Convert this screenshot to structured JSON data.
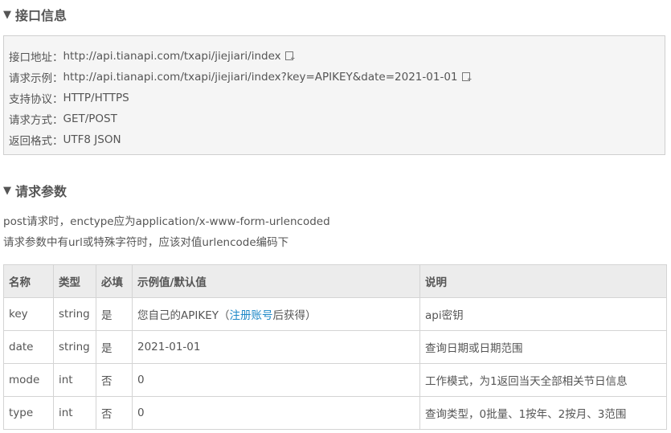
{
  "sections": {
    "info_title": "接口信息",
    "params_title": "请求参数"
  },
  "info": {
    "address_label": "接口地址：",
    "address_value": "http://api.tianapi.com/txapi/jiejiari/index",
    "example_label": "请求示例：",
    "example_value": "http://api.tianapi.com/txapi/jiejiari/index?key=APIKEY&date=2021-01-01",
    "protocol_label": "支持协议：",
    "protocol_value": "HTTP/HTTPS",
    "method_label": "请求方式：",
    "method_value": "GET/POST",
    "format_label": "返回格式：",
    "format_value": "UTF8 JSON"
  },
  "notes": {
    "line1": "post请求时，enctype应为application/x-www-form-urlencoded",
    "line2": "请求参数中有url或特殊字符时，应该对值urlencode编码下"
  },
  "table": {
    "headers": {
      "name": "名称",
      "type": "类型",
      "required": "必填",
      "example": "示例值/默认值",
      "desc": "说明"
    },
    "rows": [
      {
        "name": "key",
        "type": "string",
        "required": "是",
        "example_prefix": "您自己的APIKEY（",
        "example_link": "注册账号",
        "example_suffix": "后获得）",
        "desc": "api密钥"
      },
      {
        "name": "date",
        "type": "string",
        "required": "是",
        "example": "2021-01-01",
        "desc": "查询日期或日期范围"
      },
      {
        "name": "mode",
        "type": "int",
        "required": "否",
        "example": "0",
        "desc": "工作模式，为1返回当天全部相关节日信息"
      },
      {
        "name": "type",
        "type": "int",
        "required": "否",
        "example": "0",
        "desc": "查询类型，0批量、1按年、2按月、3范围"
      }
    ]
  },
  "icons": {
    "toggle": "triangle-down-icon",
    "copy": "copy-icon"
  },
  "colors": {
    "link": "#1e88c7",
    "box_bg": "#f5f5f5",
    "header_bg": "#ececec"
  }
}
